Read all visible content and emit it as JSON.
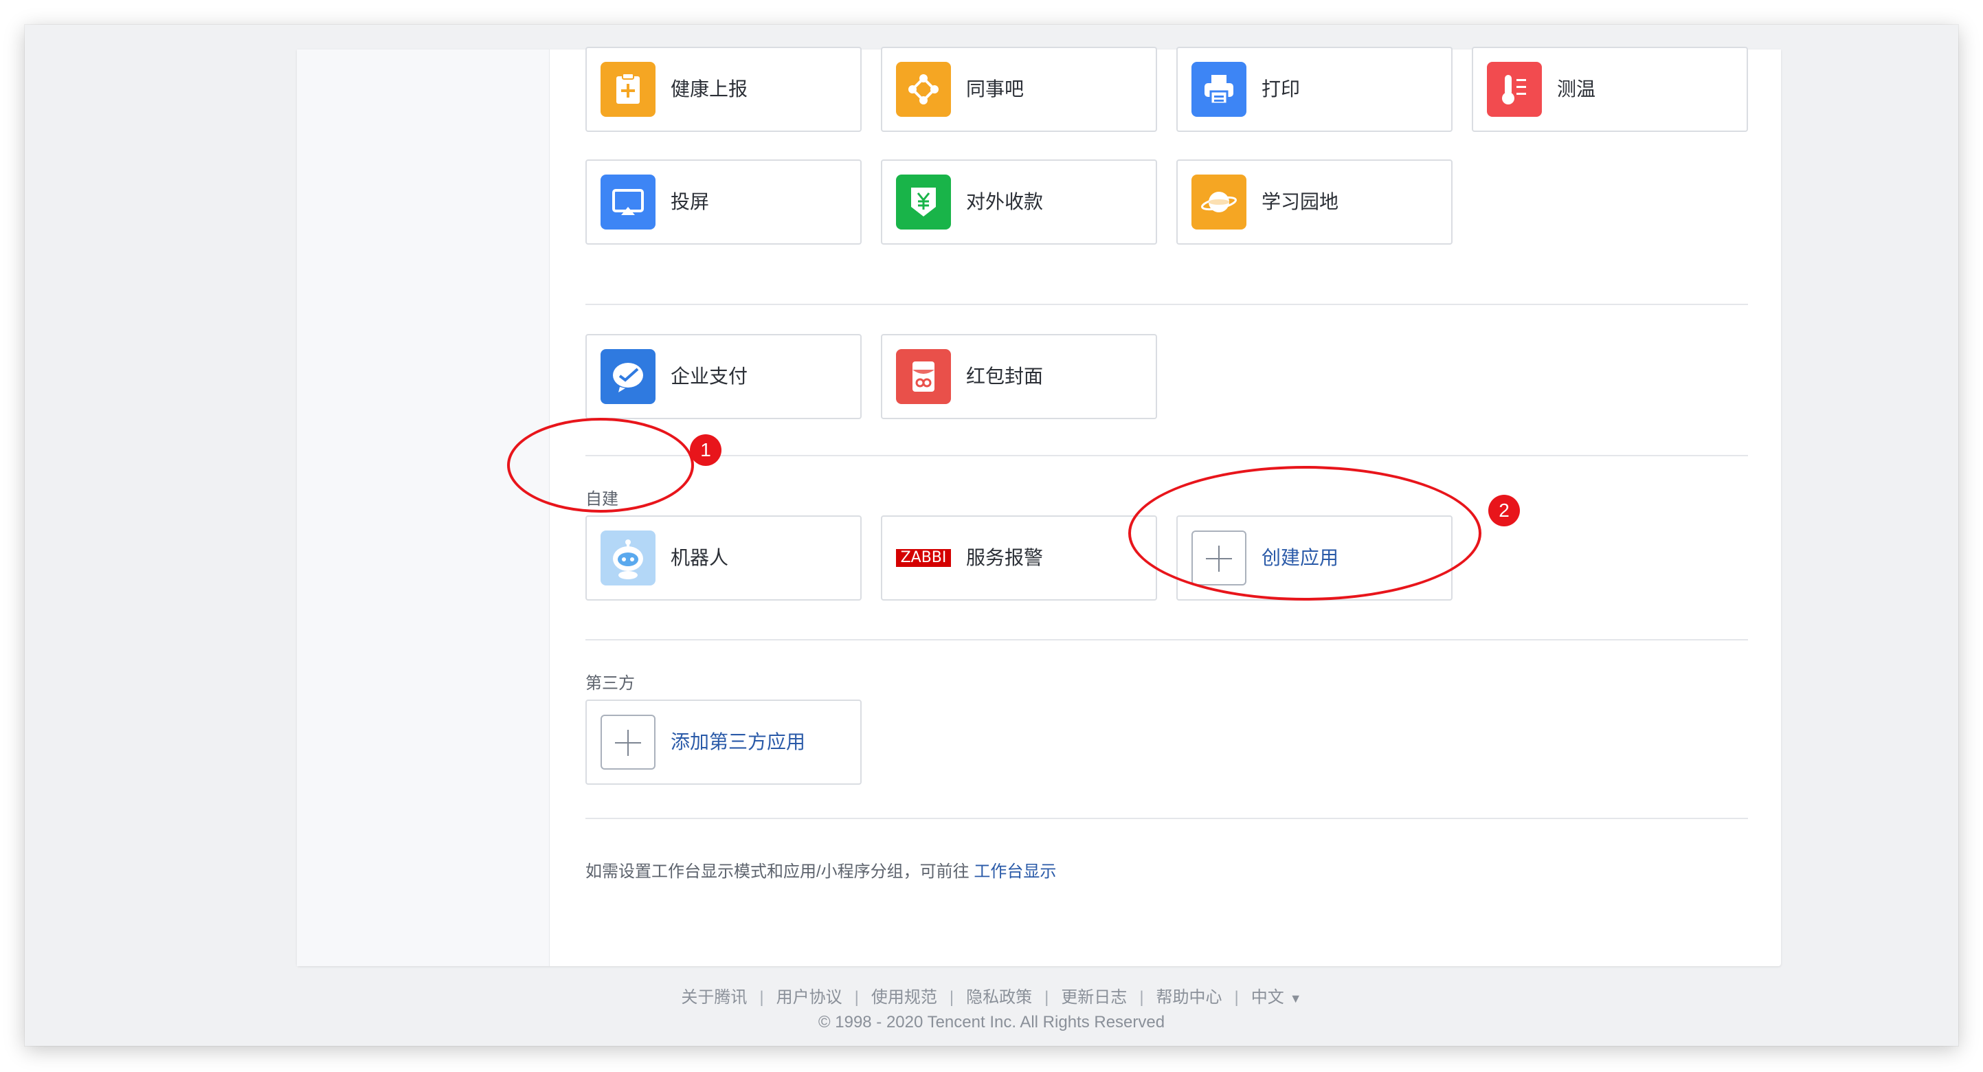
{
  "apps_row1": [
    {
      "label": "健康上报",
      "icon": "health-report-icon",
      "color": "#f5a623"
    },
    {
      "label": "同事吧",
      "icon": "colleague-forum-icon",
      "color": "#f5a623"
    },
    {
      "label": "打印",
      "icon": "printer-icon",
      "color": "#3d85f5"
    },
    {
      "label": "测温",
      "icon": "thermometer-icon",
      "color": "#f24b4f"
    }
  ],
  "apps_row2": [
    {
      "label": "投屏",
      "icon": "screen-cast-icon",
      "color": "#3d85f5"
    },
    {
      "label": "对外收款",
      "icon": "payment-collect-icon",
      "color": "#19b449"
    },
    {
      "label": "学习园地",
      "icon": "learning-planet-icon",
      "color": "#f5a623"
    }
  ],
  "apps_row3": [
    {
      "label": "企业支付",
      "icon": "enterprise-pay-icon",
      "color": "#2f7ae0"
    },
    {
      "label": "红包封面",
      "icon": "red-packet-icon",
      "color": "#e9504a"
    }
  ],
  "custom": {
    "label": "自建",
    "apps": [
      {
        "label": "机器人",
        "icon": "robot-icon"
      },
      {
        "label": "服务报警",
        "icon": "zabbix-logo-icon",
        "logo_text": "ZABBI"
      },
      {
        "label": "创建应用",
        "icon": "plus-icon"
      }
    ]
  },
  "third_party": {
    "label": "第三方",
    "add_label": "添加第三方应用"
  },
  "note": {
    "text": "如需设置工作台显示模式和应用/小程序分组，可前往",
    "link": "工作台显示"
  },
  "footer": {
    "links": [
      "关于腾讯",
      "用户协议",
      "使用规范",
      "隐私政策",
      "更新日志",
      "帮助中心"
    ],
    "language": "中文",
    "copyright": "© 1998 - 2020 Tencent Inc. All Rights Reserved"
  },
  "annotations": {
    "badge1": "1",
    "badge2": "2",
    "color": "#e8151b"
  }
}
